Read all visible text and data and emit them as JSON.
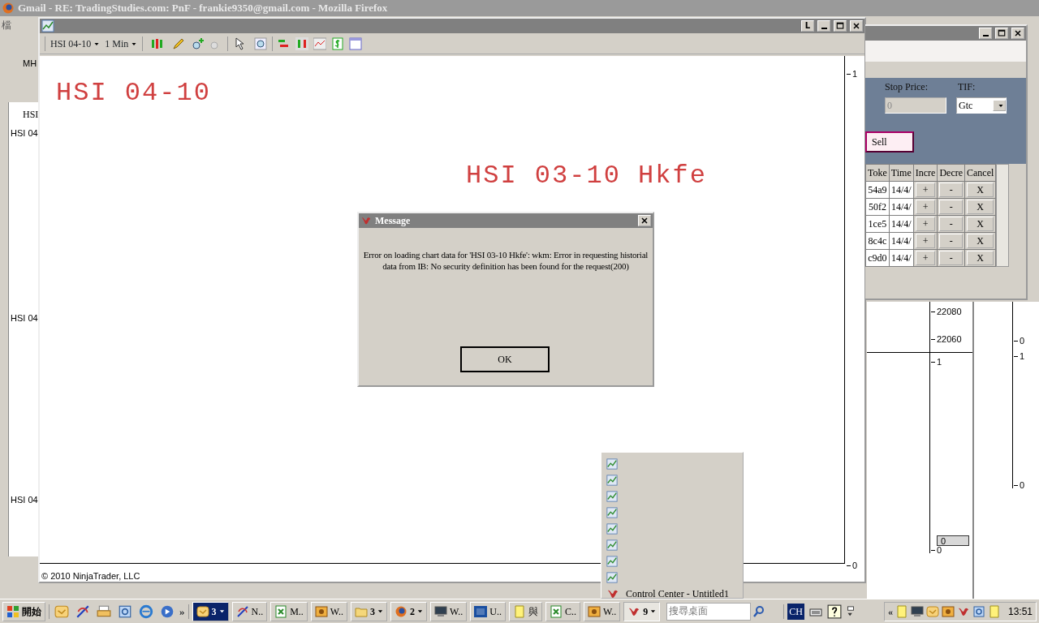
{
  "background_window": {
    "title": "Gmail - RE: TradingStudies.com: PnF - frankie9350@gmail.com - Mozilla Firefox",
    "menu_fragment": "檔"
  },
  "left_windows": [
    {
      "label": "MH"
    },
    {
      "label": "HSI"
    },
    {
      "label": "HSI 04"
    },
    {
      "label": "HSI 04"
    },
    {
      "label": "HSI 04"
    }
  ],
  "chart_window": {
    "title_buttons": [
      "L"
    ],
    "instrument": "HSI 04-10",
    "interval": "1 Min",
    "labels": [
      "HSI 04-10",
      "HSI 03-10 Hkfe"
    ],
    "axis": [
      "1",
      "0"
    ],
    "copyright": "© 2010 NinjaTrader, LLC"
  },
  "dialog": {
    "title": "Message",
    "text": "Error on loading chart data for 'HSI 03-10 Hkfe': wkm: Error in requesting historial data from IB: No security definition has been found for the request(200)",
    "button": "OK"
  },
  "order_window": {
    "stop_label": "Stop Price:",
    "stop_value": "0",
    "tif_label": "TIF:",
    "tif_value": "Gtc",
    "sell": "Sell",
    "columns": [
      "Toke",
      "Time",
      "Incre",
      "Decre",
      "Cancel"
    ],
    "rows": [
      {
        "token": "54a9",
        "time": "14/4/",
        "inc": "+",
        "dec": "-",
        "cancel": "X"
      },
      {
        "token": "50f2",
        "time": "14/4/",
        "inc": "+",
        "dec": "-",
        "cancel": "X"
      },
      {
        "token": "1ce5",
        "time": "14/4/",
        "inc": "+",
        "dec": "-",
        "cancel": "X"
      },
      {
        "token": "8c4c",
        "time": "14/4/",
        "inc": "+",
        "dec": "-",
        "cancel": "X"
      },
      {
        "token": "c9d0",
        "time": "14/4/",
        "inc": "+",
        "dec": "-",
        "cancel": "X"
      }
    ]
  },
  "right_chart": {
    "price_axis": [
      "22080",
      "22060",
      "1",
      "0"
    ],
    "marker": "0",
    "second_axis": [
      "0",
      "1",
      "0"
    ]
  },
  "task_menu": [
    {
      "kind": "chart"
    },
    {
      "kind": "chart"
    },
    {
      "kind": "chart"
    },
    {
      "kind": "chart"
    },
    {
      "kind": "chart"
    },
    {
      "kind": "chart"
    },
    {
      "kind": "chart"
    },
    {
      "kind": "chart"
    },
    {
      "kind": "app",
      "label": "Control Center - Untitled1"
    }
  ],
  "taskbar": {
    "start": "開始",
    "more": "»",
    "tasks": [
      {
        "label": "3",
        "group": true,
        "flashing": true,
        "pressed": false
      },
      {
        "label": "N..",
        "group": false,
        "flashing": false,
        "pressed": false
      },
      {
        "label": "M..",
        "group": false,
        "flashing": false,
        "pressed": false
      },
      {
        "label": "W..",
        "group": false,
        "flashing": false,
        "pressed": false
      },
      {
        "label": "3",
        "group": true,
        "flashing": false,
        "pressed": false
      },
      {
        "label": "2",
        "group": true,
        "flashing": false,
        "pressed": false
      },
      {
        "label": "W..",
        "group": false,
        "flashing": false,
        "pressed": false
      },
      {
        "label": "U..",
        "group": false,
        "flashing": false,
        "pressed": false
      },
      {
        "label": "與",
        "group": false,
        "flashing": false,
        "pressed": false
      },
      {
        "label": "C..",
        "group": false,
        "flashing": false,
        "pressed": false
      },
      {
        "label": "W..",
        "group": false,
        "flashing": false,
        "pressed": false
      },
      {
        "label": "9",
        "group": true,
        "flashing": false,
        "pressed": true
      }
    ],
    "search_placeholder": "搜尋桌面",
    "language": "CH",
    "tray_more": "«",
    "clock": "13:51"
  }
}
